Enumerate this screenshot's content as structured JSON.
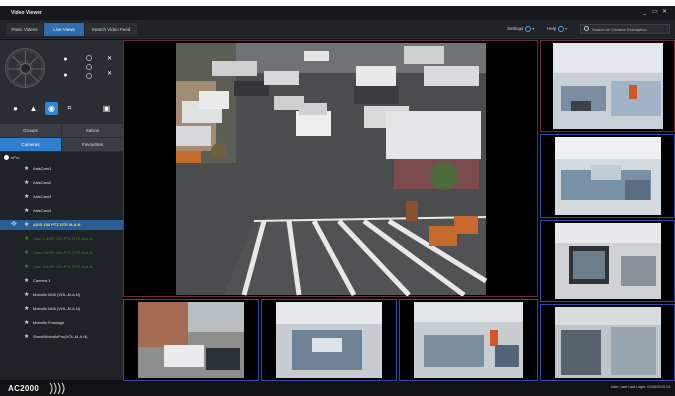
{
  "window": {
    "title": "Video Viewer",
    "controls": [
      "_",
      "▭",
      "✕"
    ]
  },
  "tabs": [
    {
      "label": "Panic Videos",
      "active": false
    },
    {
      "label": "Live Views",
      "active": true
    },
    {
      "label": "Search Video Feed",
      "active": false
    }
  ],
  "toolbar": {
    "settings_label": "Settings",
    "help_label": "Help",
    "search_placeholder": "Search on Camera Description"
  },
  "sidebar": {
    "view_options": [
      {
        "label": "Groups",
        "active": false
      },
      {
        "label": "Salvos",
        "active": false
      }
    ],
    "list_options": [
      {
        "label": "Cameras",
        "active": true
      },
      {
        "label": "Favourites",
        "active": false
      }
    ],
    "tree_root": "ePro",
    "cameras": [
      {
        "label": "AxisCam1",
        "state": "normal"
      },
      {
        "label": "AxisCam2",
        "state": "normal"
      },
      {
        "label": "AxisCam3",
        "state": "normal"
      },
      {
        "label": "AxisCam4",
        "state": "normal"
      },
      {
        "label": "AXIS 193 PTZ DTE M.A.N",
        "state": "selected"
      },
      {
        "label": "Cam 1 AXIS 193 PTZ DTE M.A.N",
        "state": "offline"
      },
      {
        "label": "Cam 2 AXIS 193 PTZ DTE M.A.N",
        "state": "offline"
      },
      {
        "label": "Cam 3 AXIS 193 PTZ DTE M.A.N",
        "state": "offline"
      },
      {
        "label": "Camera 1",
        "state": "normal"
      },
      {
        "label": "Mobotix M05 (VOL-M.A.N)",
        "state": "normal"
      },
      {
        "label": "Mobotix M05 (VOL-M.A.N)",
        "state": "normal"
      },
      {
        "label": "Mobotix Frontage",
        "state": "normal"
      },
      {
        "label": "Stock/MobotixPro(VOL-M.A.N)",
        "state": "normal"
      }
    ]
  },
  "status": {
    "brand": "AC2000",
    "text": "User: user  Last Login: 01/05/2019 14:"
  },
  "colors": {
    "accent": "#2a6fb0",
    "selected_row": "#2a5d93",
    "selected_text": "#f3e24b",
    "offline_text": "#2f8f2f",
    "tile_border_red": "#6a2d3d",
    "tile_border_blue": "#3b45a8"
  }
}
